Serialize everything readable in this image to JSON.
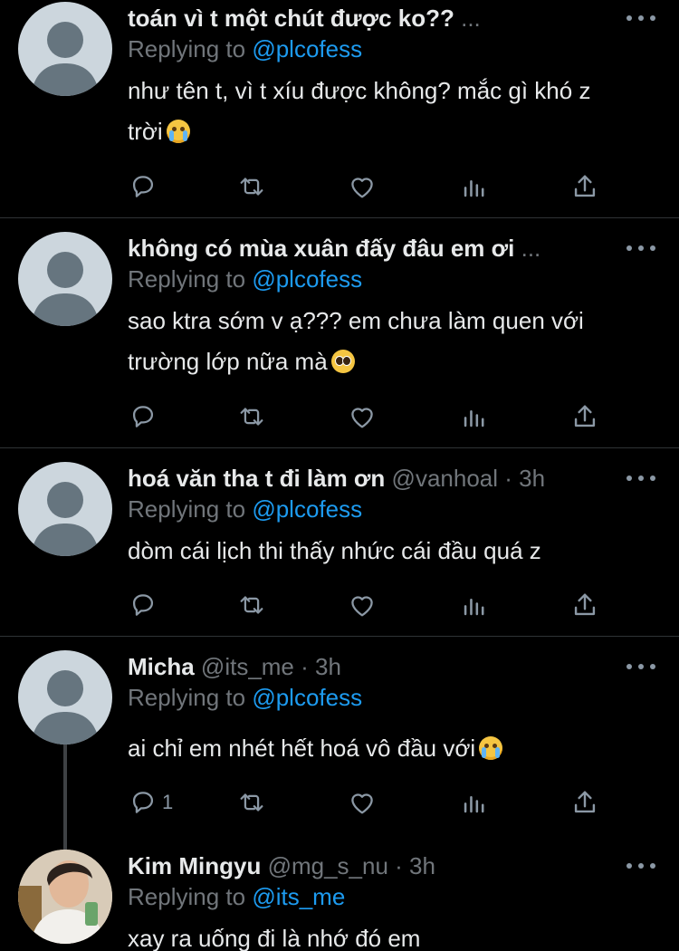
{
  "tweets": [
    {
      "name": "toán vì t một chút được ko??",
      "handle": "",
      "time": "",
      "truncated": "...",
      "replying_label": "Replying to",
      "replying_to": "@plcofess",
      "text_lines": [
        "như tên t, vì t xíu được không? mắc gì khó z",
        "trời"
      ],
      "emoji": "loudly-crying-face-emoji",
      "reply_count": ""
    },
    {
      "name": "không có mùa xuân đấy đâu em ơi",
      "handle": "",
      "time": "",
      "truncated": "...",
      "replying_label": "Replying to",
      "replying_to": "@plcofess",
      "text_lines": [
        "sao ktra sớm v ạ??? em chưa làm quen với",
        "trường lớp nữa mà"
      ],
      "emoji": "pleading-face-emoji",
      "reply_count": ""
    },
    {
      "name": "hoá văn tha t đi làm ơn",
      "handle": "@vanhoal",
      "time": "· 3h",
      "truncated": "",
      "replying_label": "Replying to",
      "replying_to": "@plcofess",
      "text_lines": [
        "dòm cái lịch thi thấy nhức cái đầu quá z"
      ],
      "emoji": "",
      "reply_count": ""
    },
    {
      "name": "Micha",
      "handle": "@its_me",
      "time": "· 3h",
      "truncated": "",
      "replying_label": "Replying to",
      "replying_to": "@plcofess",
      "text_lines": [
        "ai chỉ em nhét hết hoá vô đầu với"
      ],
      "emoji": "loudly-crying-face-emoji",
      "reply_count": "1"
    },
    {
      "name": "Kim Mingyu",
      "handle": "@mg_s_nu",
      "time": "· 3h",
      "truncated": "",
      "replying_label": "Replying to",
      "replying_to": "@its_me",
      "text_lines": [
        "xay ra uống đi là nhớ đó em"
      ],
      "emoji": "",
      "reply_count": ""
    }
  ],
  "icons": {
    "reply": "reply-icon",
    "retweet": "retweet-icon",
    "like": "heart-icon",
    "analytics": "analytics-icon",
    "share": "share-icon",
    "more": "more-icon"
  },
  "colors": {
    "background": "#000000",
    "text": "#e7e9ea",
    "muted": "#71767b",
    "accent": "#1d9bf0",
    "divider": "#2f3336"
  }
}
